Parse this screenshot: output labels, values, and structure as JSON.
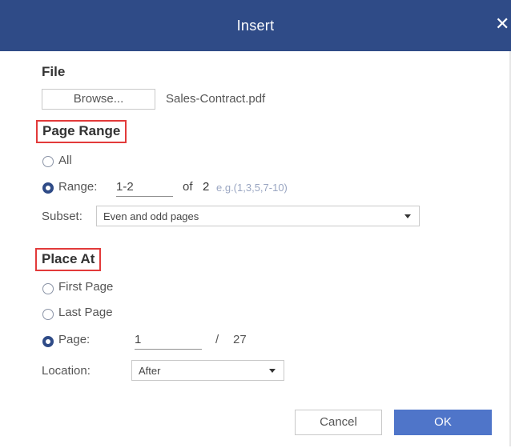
{
  "dialog": {
    "title": "Insert",
    "close_glyph": "✕"
  },
  "file": {
    "section_label": "File",
    "browse_label": "Browse...",
    "filename": "Sales-Contract.pdf"
  },
  "page_range": {
    "section_label": "Page Range",
    "all_label": "All",
    "range_label": "Range:",
    "range_value": "1-2",
    "of_label": "of",
    "total_pages": "2",
    "example_hint": "e.g.(1,3,5,7-10)",
    "subset_label": "Subset:",
    "subset_value": "Even and odd pages",
    "selected": "range"
  },
  "place_at": {
    "section_label": "Place At",
    "first_page_label": "First Page",
    "last_page_label": "Last Page",
    "page_label": "Page:",
    "page_value": "1",
    "slash": "/",
    "page_total": "27",
    "location_label": "Location:",
    "location_value": "After",
    "selected": "page"
  },
  "footer": {
    "cancel_label": "Cancel",
    "ok_label": "OK"
  },
  "colors": {
    "titlebar": "#2f4b87",
    "accent": "#4f75c9",
    "highlight_box": "#e23a3a"
  }
}
